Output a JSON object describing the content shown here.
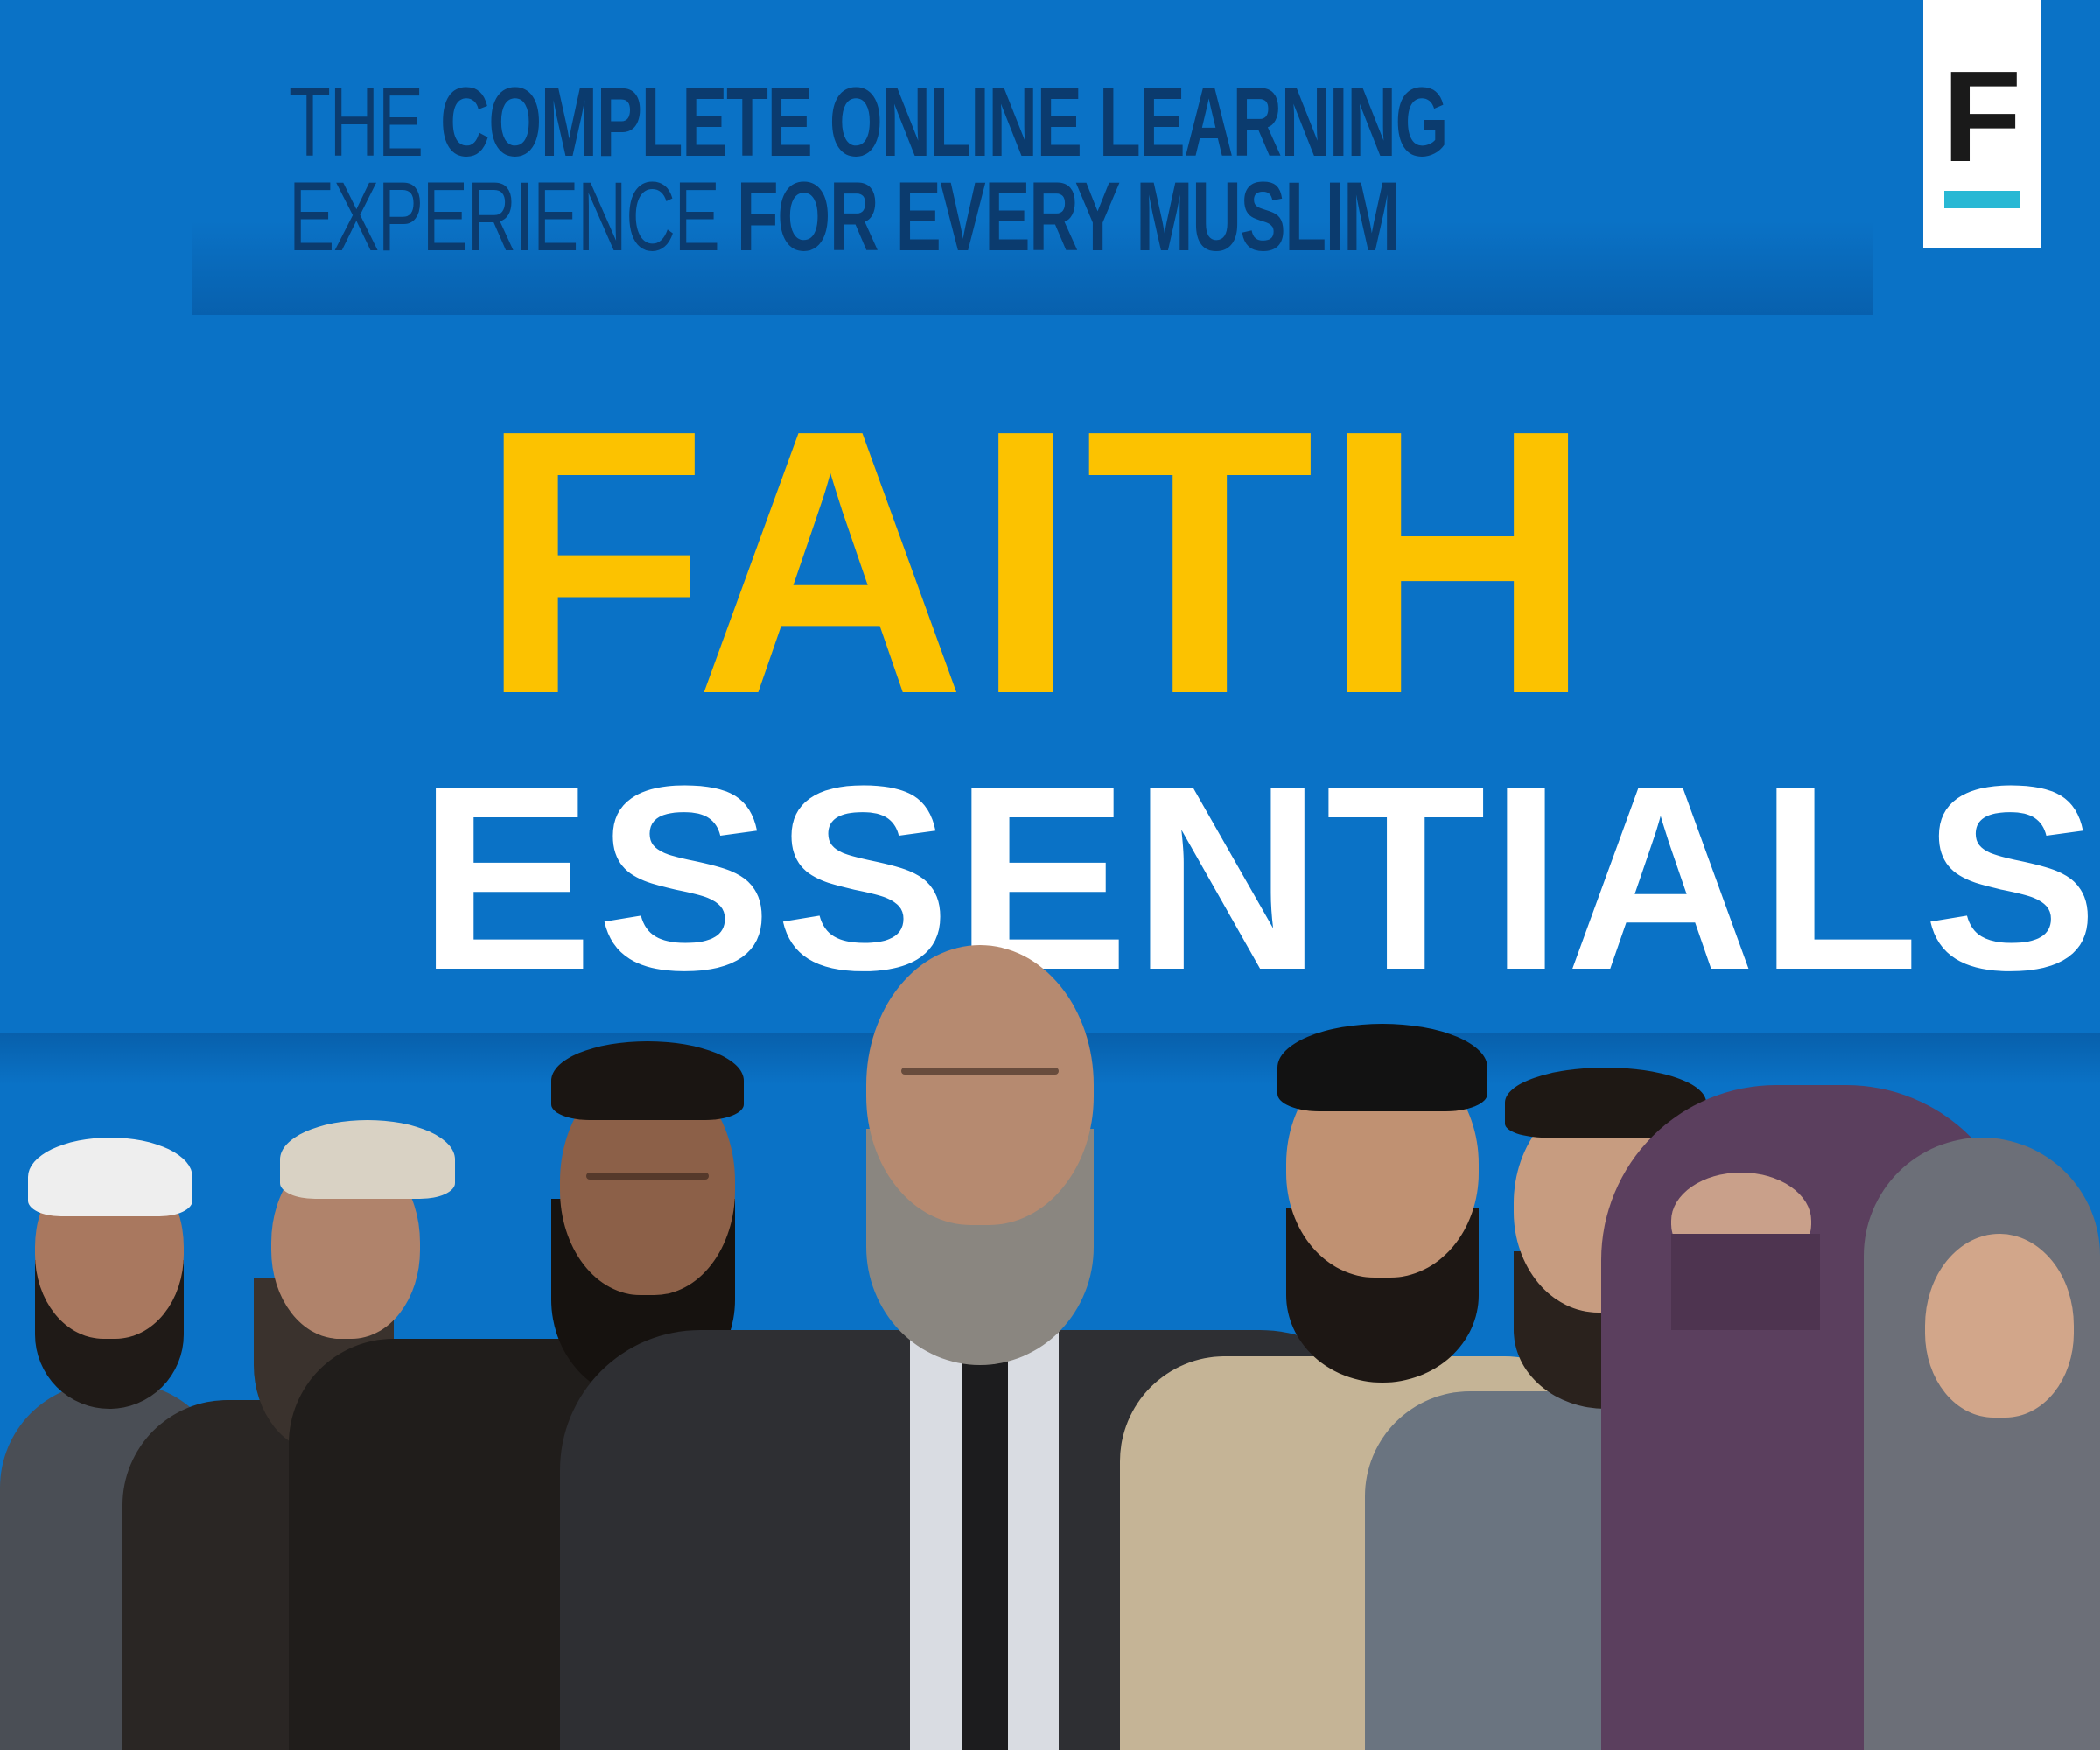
{
  "tagline": {
    "line1_light": "THE ",
    "line1_bold": "COMPLETE ONLINE LEARNING",
    "line2_light": "EXPERIENCE ",
    "line2_bold": "FOR EVERY MUSLIM"
  },
  "logo": {
    "letter": "F"
  },
  "title": {
    "main": "FAITH",
    "sub": "ESSENTIALS"
  },
  "colors": {
    "background": "#0a72c6",
    "tagline": "#0b3b6e",
    "title_main": "#fcc200",
    "title_sub": "#ffffff",
    "logo_accent": "#28b8d4"
  }
}
